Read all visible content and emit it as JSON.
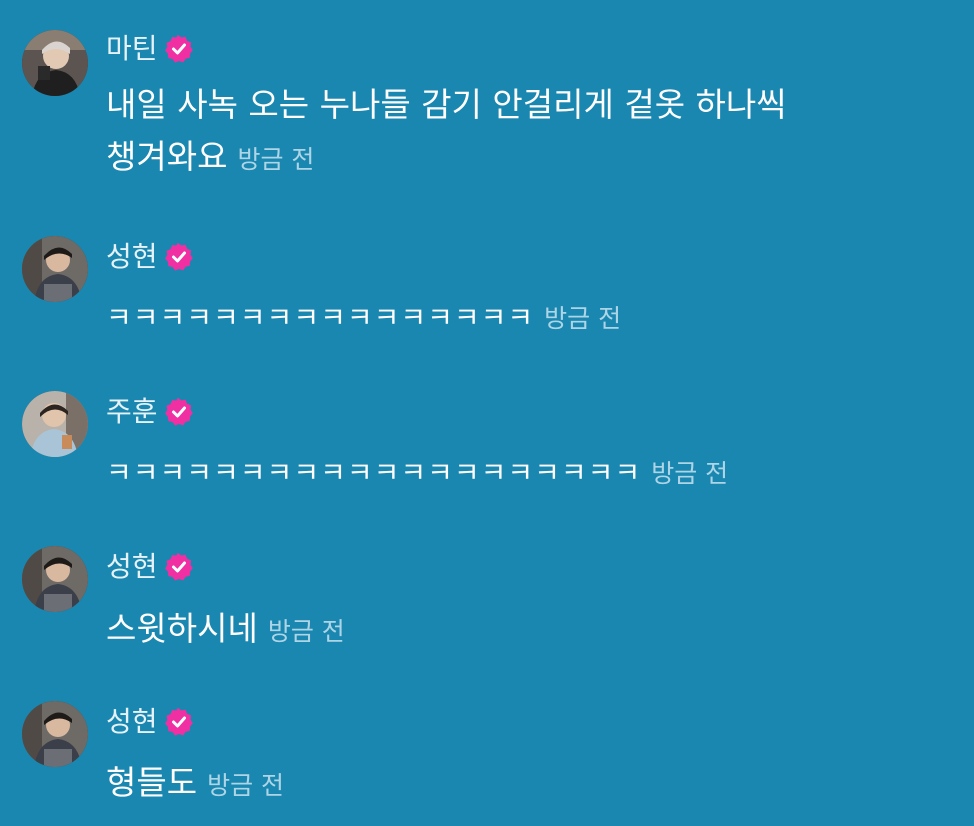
{
  "messages": [
    {
      "name": "마틴",
      "text": "내일 사녹 오는 누나들 감기 안걸리게 겉옷 하나씩 챙겨와요",
      "time": "방금 전",
      "avatar": "martin-avatar"
    },
    {
      "name": "성현",
      "text": "ㅋㅋㅋㅋㅋㅋㅋㅋㅋㅋㅋㅋㅋㅋㅋㅋ",
      "time": "방금 전",
      "avatar": "sunghyun-avatar"
    },
    {
      "name": "주훈",
      "text": "ㅋㅋㅋㅋㅋㅋㅋㅋㅋㅋㅋㅋㅋㅋㅋㅋㅋㅋㅋㅋ",
      "time": "방금 전",
      "avatar": "juhoon-avatar"
    },
    {
      "name": "성현",
      "text": "스윗하시네",
      "time": "방금 전",
      "avatar": "sunghyun-avatar"
    },
    {
      "name": "성현",
      "text": "형들도",
      "time": "방금 전",
      "avatar": "sunghyun-avatar"
    }
  ],
  "colors": {
    "background": "#1a87b0",
    "badge": "#f02fa3",
    "timestamp": "#aed5e6"
  },
  "icons": {
    "verified": "verified-badge-icon"
  }
}
